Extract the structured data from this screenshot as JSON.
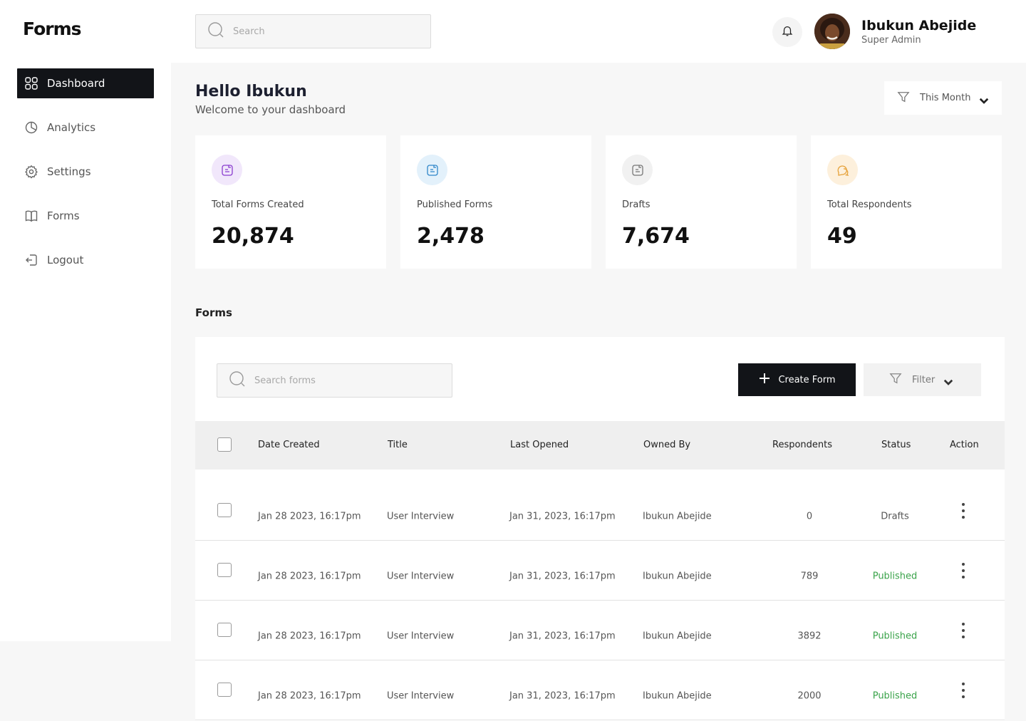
{
  "app": {
    "logo": "Forms"
  },
  "sidebar": {
    "items": [
      {
        "label": "Dashboard",
        "icon": "grid-icon",
        "active": true
      },
      {
        "label": "Analytics",
        "icon": "pie-chart-icon",
        "active": false
      },
      {
        "label": "Settings",
        "icon": "gear-icon",
        "active": false
      },
      {
        "label": "Forms",
        "icon": "book-icon",
        "active": false
      },
      {
        "label": "Logout",
        "icon": "logout-icon",
        "active": false
      }
    ]
  },
  "header": {
    "search_placeholder": "Search",
    "user_name": "Ibukun Abejide",
    "user_role": "Super Admin"
  },
  "greeting": {
    "title": "Hello Ibukun",
    "subtitle": "Welcome to your dashboard"
  },
  "period_filter": {
    "label": "This Month"
  },
  "stats": [
    {
      "label": "Total Forms Created",
      "value": "20,874",
      "icon": "document-icon",
      "color": "#8a3ccf",
      "bg": "#f1e7fb"
    },
    {
      "label": "Published Forms",
      "value": "2,478",
      "icon": "document-icon",
      "color": "#2f86c9",
      "bg": "#e3f1fb"
    },
    {
      "label": "Drafts",
      "value": "7,674",
      "icon": "document-icon",
      "color": "#777777",
      "bg": "#f1f1f1"
    },
    {
      "label": "Total Respondents",
      "value": "49",
      "icon": "chat-icon",
      "color": "#e6a23a",
      "bg": "#fdf0dc"
    }
  ],
  "forms_section": {
    "title": "Forms",
    "search_placeholder": "Search forms",
    "create_label": "Create Form",
    "filter_label": "Filter",
    "columns": [
      "Date Created",
      "Title",
      "Last Opened",
      "Owned By",
      "Respondents",
      "Status",
      "Action"
    ],
    "rows": [
      {
        "date_created": "Jan 28 2023, 16:17pm",
        "title": "User Interview",
        "last_opened": "Jan 31, 2023, 16:17pm",
        "owner": "Ibukun Abejide",
        "respondents": "0",
        "status": "Drafts"
      },
      {
        "date_created": "Jan 28 2023, 16:17pm",
        "title": "User Interview",
        "last_opened": "Jan 31, 2023, 16:17pm",
        "owner": "Ibukun Abejide",
        "respondents": "789",
        "status": "Published"
      },
      {
        "date_created": "Jan 28 2023, 16:17pm",
        "title": "User Interview",
        "last_opened": "Jan 31, 2023, 16:17pm",
        "owner": "Ibukun Abejide",
        "respondents": "3892",
        "status": "Published"
      },
      {
        "date_created": "Jan 28 2023, 16:17pm",
        "title": "User Interview",
        "last_opened": "Jan 31, 2023, 16:17pm",
        "owner": "Ibukun Abejide",
        "respondents": "2000",
        "status": "Published"
      }
    ],
    "status_colors": {
      "Drafts": "#555555",
      "Published": "#3aa34a"
    }
  }
}
